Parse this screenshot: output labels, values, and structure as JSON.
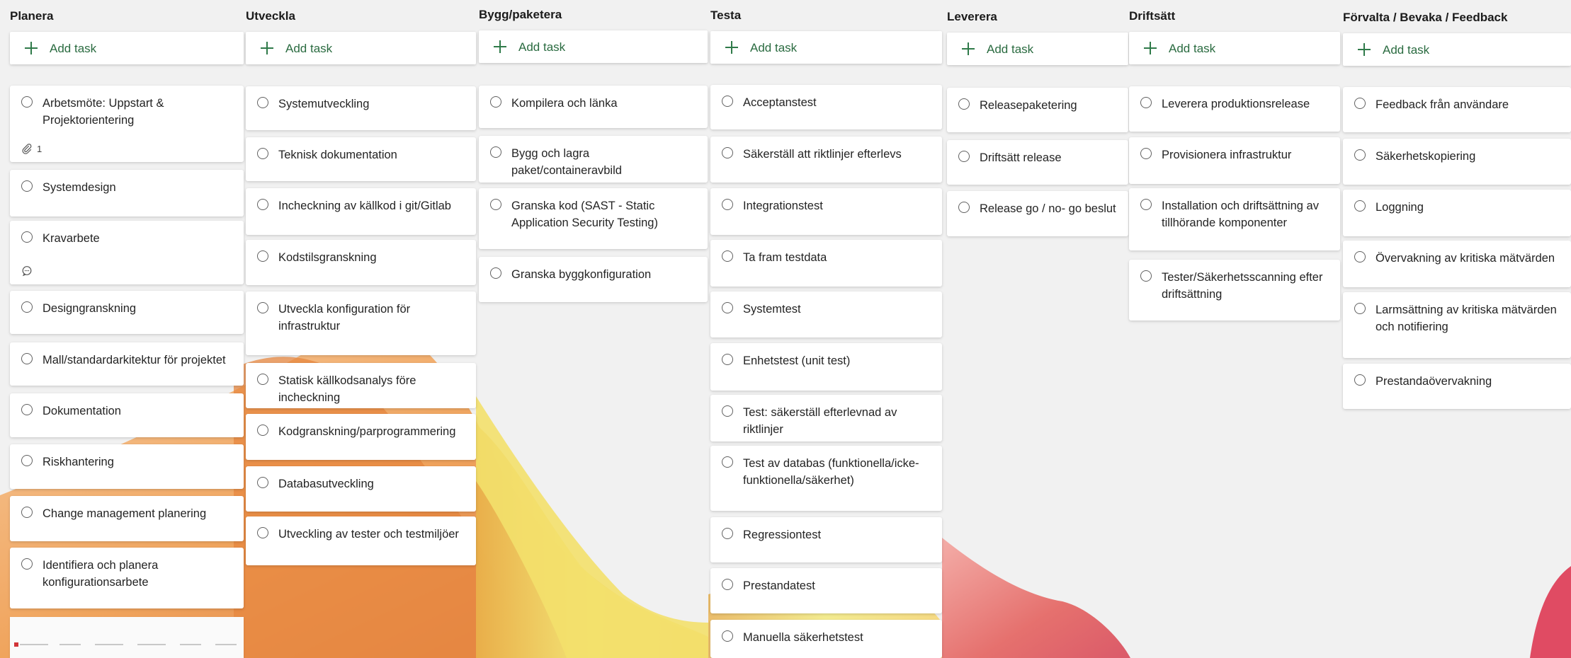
{
  "theme": {
    "accent": "#2f7a49",
    "card_bg": "#ffffff",
    "board_bg": "#f1f1f1"
  },
  "add_task_label": "Add task",
  "buckets": [
    {
      "name": "Planera",
      "tasks": [
        {
          "title": "Arbetsmöte: Uppstart & Projektorientering",
          "attachments": "1"
        },
        {
          "title": "Systemdesign"
        },
        {
          "title": "Kravarbete",
          "comment_icon": true
        },
        {
          "title": "Designgranskning"
        },
        {
          "title": "Mall/standardarkitektur för projektet"
        },
        {
          "title": "Dokumentation"
        },
        {
          "title": "Riskhantering"
        },
        {
          "title": "Change management planering"
        },
        {
          "title": "Identifiera och planera konfigurationsarbete"
        }
      ]
    },
    {
      "name": "Utveckla",
      "tasks": [
        {
          "title": "Systemutveckling"
        },
        {
          "title": "Teknisk dokumentation"
        },
        {
          "title": "Incheckning av källkod i git/Gitlab"
        },
        {
          "title": "Kodstilsgranskning"
        },
        {
          "title": "Utveckla konfiguration för infrastruktur"
        },
        {
          "title": "Statisk källkodsanalys före incheckning"
        },
        {
          "title": "Kodgranskning/parprogrammering"
        },
        {
          "title": "Databasutveckling"
        },
        {
          "title": "Utveckling av tester och testmiljöer"
        }
      ]
    },
    {
      "name": "Bygg/paketera",
      "tasks": [
        {
          "title": "Kompilera och länka"
        },
        {
          "title": "Bygg och lagra paket/containeravbild"
        },
        {
          "title": "Granska kod (SAST - Static Application Security Testing)"
        },
        {
          "title": "Granska byggkonfiguration"
        }
      ]
    },
    {
      "name": "Testa",
      "tasks": [
        {
          "title": "Acceptanstest"
        },
        {
          "title": "Säkerställ att riktlinjer efterlevs"
        },
        {
          "title": "Integrationstest"
        },
        {
          "title": "Ta fram testdata"
        },
        {
          "title": "Systemtest"
        },
        {
          "title": "Enhetstest (unit test)"
        },
        {
          "title": "Test: säkerställ efterlevnad av riktlinjer"
        },
        {
          "title": "Test av databas (funktionella/icke-funktionella/säkerhet)"
        },
        {
          "title": "Regressiontest"
        },
        {
          "title": "Prestandatest"
        },
        {
          "title": "Manuella säkerhetstest"
        }
      ]
    },
    {
      "name": "Leverera",
      "tasks": [
        {
          "title": "Releasepaketering"
        },
        {
          "title": "Driftsätt release"
        },
        {
          "title": "Release go / no- go beslut"
        }
      ]
    },
    {
      "name": "Driftsätt",
      "tasks": [
        {
          "title": "Leverera produktionsrelease"
        },
        {
          "title": "Provisionera infrastruktur"
        },
        {
          "title": "Installation och driftsättning av tillhörande komponenter"
        },
        {
          "title": "Tester/Säkerhetsscanning efter driftsättning"
        }
      ]
    },
    {
      "name": "Förvalta / Bevaka / Feedback",
      "tasks": [
        {
          "title": "Feedback från användare"
        },
        {
          "title": "Säkerhetskopiering"
        },
        {
          "title": "Loggning"
        },
        {
          "title": "Övervakning av kritiska mätvärden"
        },
        {
          "title": "Larmsättning av kritiska mätvärden och notifiering"
        },
        {
          "title": "Prestandaövervakning"
        }
      ]
    }
  ]
}
